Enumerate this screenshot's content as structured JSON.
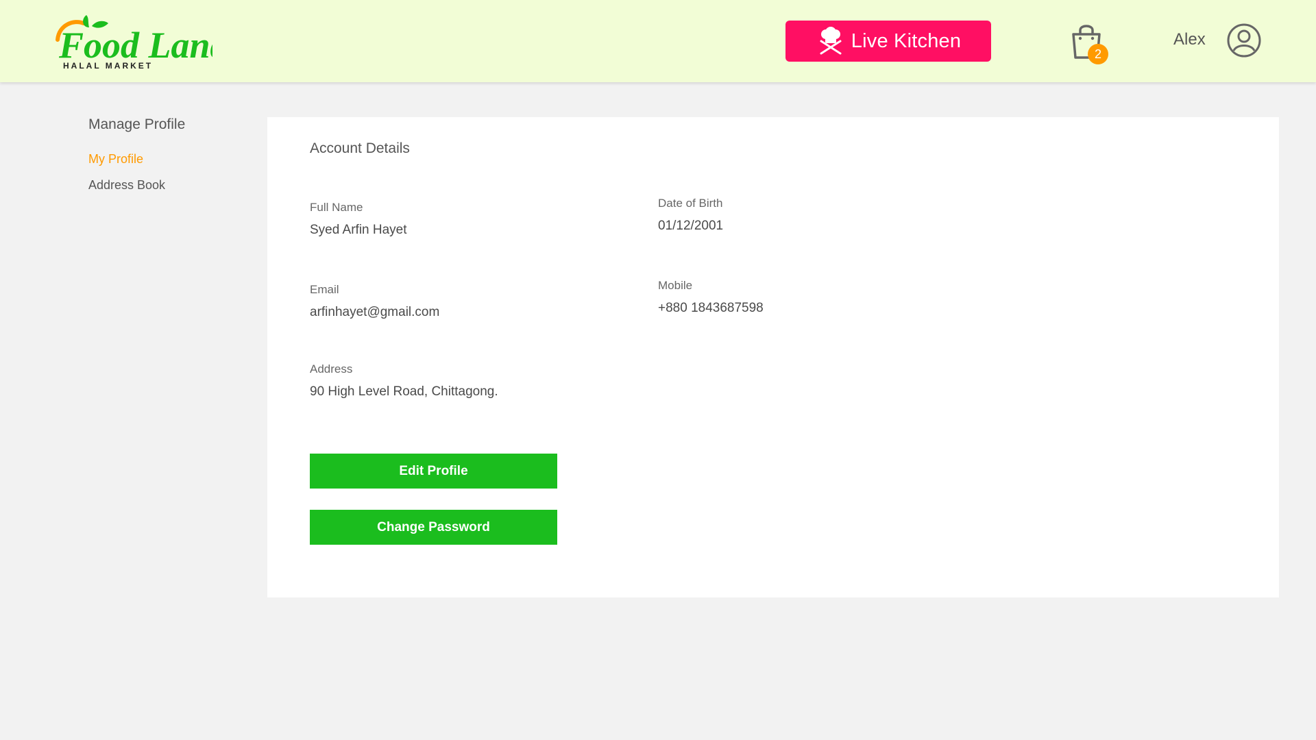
{
  "brand": {
    "name": "Food Land",
    "tagline": "HALAL MARKET",
    "colors": {
      "green": "#1bbd1e",
      "orange": "#ff9a00",
      "pink": "#ff0f63",
      "header_bg": "#f2fdd6"
    }
  },
  "header": {
    "live_kitchen_label": "Live Kitchen",
    "live_kitchen_icon": "chef-hat-icon",
    "cart_icon": "shopping-bag-icon",
    "cart_count": "2",
    "username": "Alex",
    "avatar_icon": "user-circle-icon"
  },
  "sidebar": {
    "title": "Manage Profile",
    "items": [
      {
        "label": "My Profile",
        "active": true
      },
      {
        "label": "Address Book",
        "active": false
      }
    ]
  },
  "account": {
    "title": "Account Details",
    "full_name_label": "Full Name",
    "full_name": "Syed Arfin Hayet",
    "dob_label": "Date of Birth",
    "dob": "01/12/2001",
    "email_label": "Email",
    "email": "arfinhayet@gmail.com",
    "mobile_label": "Mobile",
    "mobile": "+880 1843687598",
    "address_label": "Address",
    "address": "90 High Level Road, Chittagong.",
    "edit_button": "Edit Profile",
    "password_button": "Change Password"
  }
}
